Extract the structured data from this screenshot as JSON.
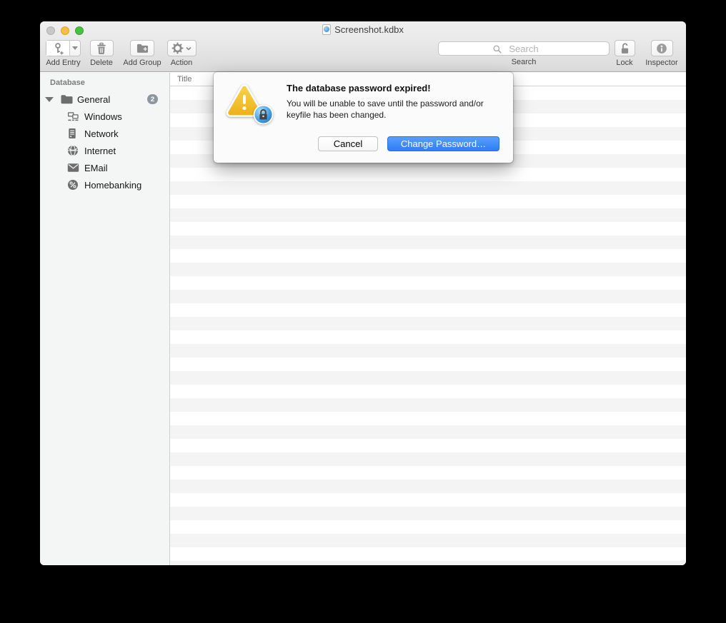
{
  "window": {
    "title": "Screenshot.kdbx"
  },
  "toolbar": {
    "add_entry": {
      "label": "Add Entry",
      "icon": "key-plus-icon"
    },
    "delete": {
      "label": "Delete",
      "icon": "trash-icon"
    },
    "add_group": {
      "label": "Add Group",
      "icon": "folder-plus-icon"
    },
    "action": {
      "label": "Action",
      "icon": "gear-icon"
    },
    "search": {
      "label": "Search",
      "placeholder": "Search",
      "icon": "magnifier-icon"
    },
    "lock": {
      "label": "Lock",
      "icon": "open-padlock-icon"
    },
    "inspector": {
      "label": "Inspector",
      "icon": "info-icon"
    }
  },
  "sidebar": {
    "header": "Database",
    "groups": [
      {
        "label": "General",
        "badge": "2",
        "icon": "folder-icon",
        "expanded": true,
        "children": [
          {
            "label": "Windows",
            "icon": "workstations-icon"
          },
          {
            "label": "Network",
            "icon": "server-icon"
          },
          {
            "label": "Internet",
            "icon": "globe-icon"
          },
          {
            "label": "EMail",
            "icon": "envelope-icon"
          },
          {
            "label": "Homebanking",
            "icon": "percent-icon"
          }
        ]
      }
    ]
  },
  "entry_table": {
    "columns": [
      "Title"
    ],
    "rows": []
  },
  "dialog": {
    "title": "The database password expired!",
    "message": "You will be unable to save until the password and/or keyfile has been changed.",
    "icon": "warning-triangle-lock-icon",
    "buttons": {
      "cancel": "Cancel",
      "change_password": "Change Password…"
    }
  },
  "colors": {
    "accent_blue": "#3b84f8",
    "warning_yellow": "#f2bf2d",
    "badge_gray": "#8d97a1",
    "row_stripe": "#f4f4f5"
  }
}
